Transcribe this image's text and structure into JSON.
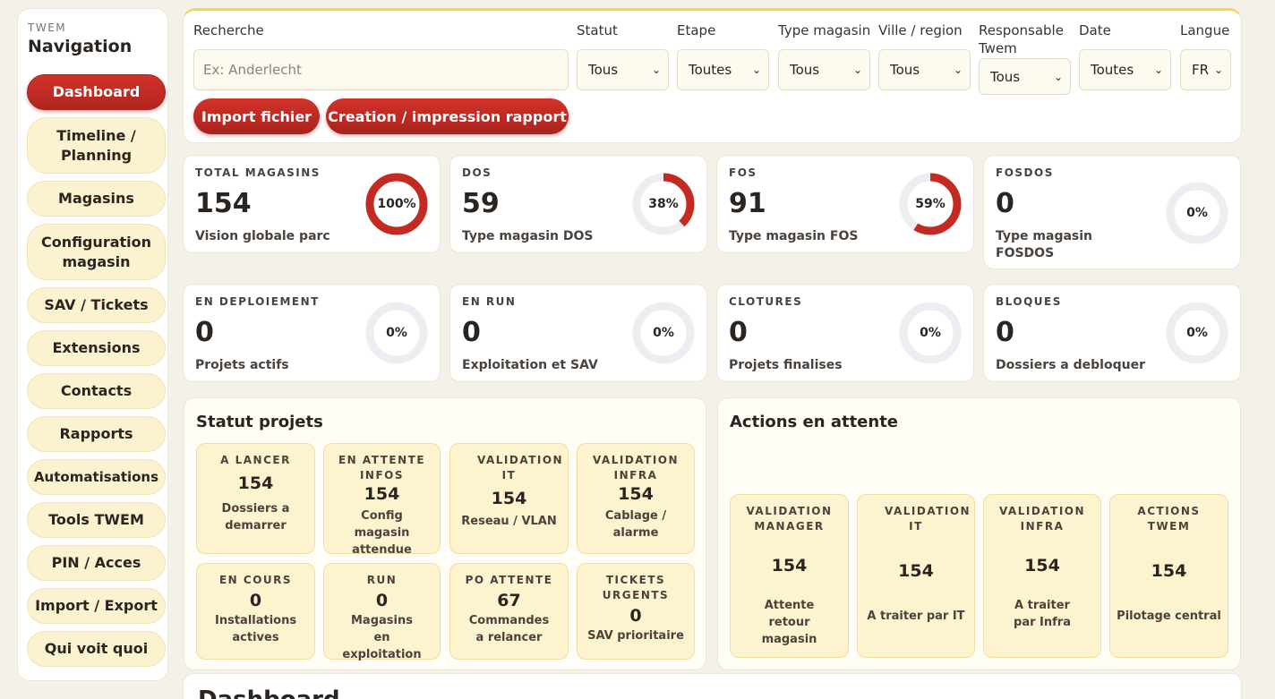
{
  "sidebar": {
    "brand": "TWEM",
    "title": "Navigation",
    "items": [
      {
        "label": "Dashboard",
        "active": true
      },
      {
        "label": "Timeline / Planning"
      },
      {
        "label": "Magasins"
      },
      {
        "label": "Configuration magasin"
      },
      {
        "label": "SAV / Tickets"
      },
      {
        "label": "Extensions"
      },
      {
        "label": "Contacts"
      },
      {
        "label": "Rapports"
      },
      {
        "label": "Automatisations"
      },
      {
        "label": "Tools TWEM"
      },
      {
        "label": "PIN / Acces"
      },
      {
        "label": "Import / Export"
      },
      {
        "label": "Qui voit quoi"
      }
    ]
  },
  "filters": {
    "search_label": "Recherche",
    "search_placeholder": "Ex: Anderlecht",
    "statut_label": "Statut",
    "statut_value": "Tous",
    "etape_label": "Etape",
    "etape_value": "Toutes",
    "type_label": "Type magasin",
    "type_value": "Tous",
    "ville_label": "Ville / region",
    "ville_value": "Tous",
    "responsable_label": "Responsable Twem",
    "responsable_value": "Tous",
    "date_label": "Date",
    "date_value": "Toutes",
    "langue_label": "Langue",
    "langue_value": "FR",
    "import_button": "Import fichier",
    "report_button": "Creation / impression rapport"
  },
  "kpis": [
    {
      "label": "TOTAL MAGASINS",
      "value": "154",
      "sub": "Vision globale parc",
      "percent_text": "100%",
      "percent": 100
    },
    {
      "label": "DOS",
      "value": "59",
      "sub": "Type magasin DOS",
      "percent_text": "38%",
      "percent": 38
    },
    {
      "label": "FOS",
      "value": "91",
      "sub": "Type magasin FOS",
      "percent_text": "59%",
      "percent": 59
    },
    {
      "label": "FOSDOS",
      "value": "0",
      "sub": "Type magasin FOSDOS",
      "percent_text": "0%",
      "percent": 0
    },
    {
      "label": "EN DEPLOIEMENT",
      "value": "0",
      "sub": "Projets actifs",
      "percent_text": "0%",
      "percent": 0
    },
    {
      "label": "EN RUN",
      "value": "0",
      "sub": "Exploitation et SAV",
      "percent_text": "0%",
      "percent": 0
    },
    {
      "label": "CLOTURES",
      "value": "0",
      "sub": "Projets finalises",
      "percent_text": "0%",
      "percent": 0
    },
    {
      "label": "BLOQUES",
      "value": "0",
      "sub": "Dossiers a debloquer",
      "percent_text": "0%",
      "percent": 0
    }
  ],
  "statut_projets": {
    "title": "Statut projets",
    "tiles": [
      {
        "label": "A LANCER",
        "value": "154",
        "sub": "Dossiers a demarrer"
      },
      {
        "label": "EN ATTENTE INFOS",
        "value": "154",
        "sub": "Config magasin attendue"
      },
      {
        "label": "VALIDATION IT",
        "value": "154",
        "sub": "Reseau / VLAN"
      },
      {
        "label": "VALIDATION INFRA",
        "value": "154",
        "sub": "Cablage / alarme"
      },
      {
        "label": "EN COURS",
        "value": "0",
        "sub": "Installations actives"
      },
      {
        "label": "RUN",
        "value": "0",
        "sub": "Magasins en exploitation"
      },
      {
        "label": "PO ATTENTE",
        "value": "67",
        "sub": "Commandes a relancer"
      },
      {
        "label": "TICKETS URGENTS",
        "value": "0",
        "sub": "SAV prioritaire"
      }
    ]
  },
  "actions": {
    "title": "Actions en attente",
    "tiles": [
      {
        "label": "VALIDATION MANAGER",
        "value": "154",
        "sub": "Attente retour magasin"
      },
      {
        "label": "VALIDATION IT",
        "value": "154",
        "sub": "A traiter par IT"
      },
      {
        "label": "VALIDATION INFRA",
        "value": "154",
        "sub": "A traiter par Infra"
      },
      {
        "label": "ACTIONS TWEM",
        "value": "154",
        "sub": "Pilotage central"
      }
    ]
  },
  "bottom": {
    "title": "Dashboard"
  },
  "colors": {
    "accent": "#c22a22",
    "track": "#eeeef2",
    "tile": "#fdf3cf",
    "highlight": "#f2d657"
  }
}
